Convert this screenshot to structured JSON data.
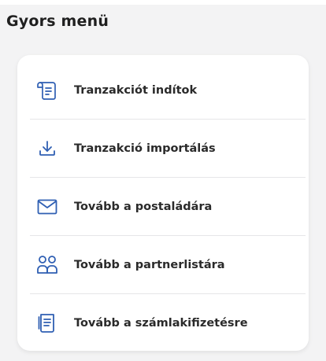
{
  "header": {
    "title": "Gyors menü"
  },
  "menu": {
    "items": [
      {
        "label": "Tranzakciót indítok",
        "icon": "transaction-start-icon"
      },
      {
        "label": "Tranzakció importálás",
        "icon": "download-icon"
      },
      {
        "label": "Tovább a postaládára",
        "icon": "mail-icon"
      },
      {
        "label": "Tovább a partnerlistára",
        "icon": "partners-icon"
      },
      {
        "label": "Tovább a számlakifizetésre",
        "icon": "invoice-icon"
      }
    ]
  },
  "colors": {
    "icon_blue": "#2f5fb3",
    "text": "#2a2a2a",
    "background": "#f3f3f4",
    "card": "#ffffff"
  }
}
